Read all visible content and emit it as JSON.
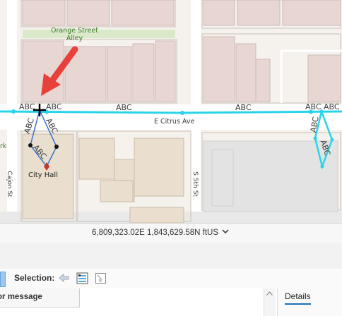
{
  "map": {
    "street_labels": {
      "alley": "Orange Street\nAlley",
      "citrus": "E Citrus Ave",
      "cajon": "Cajon St",
      "fifth": "S 5th St",
      "park": "rk"
    },
    "place_label": "City Hall",
    "annotation_text": "ABC",
    "colors": {
      "road_line": "#2ad4e8",
      "parcel_outline": "#3d73c8",
      "arrow": "#e8413c",
      "building": "#e9d9d6",
      "building2": "#eadfce",
      "vertex_marker": "#c0392b"
    }
  },
  "status_bar": {
    "coordinates": "6,809,323.02E 1,843,629.58N ftUS",
    "chevron_icon": "chevron-down-icon"
  },
  "toolbar": {
    "selection_label": "Selection:",
    "icons": [
      "zoom-to-selection-icon",
      "select-all-icon",
      "clear-selection-icon"
    ]
  },
  "table": {
    "column_header": "or message"
  },
  "details": {
    "tab_label": "Details"
  }
}
